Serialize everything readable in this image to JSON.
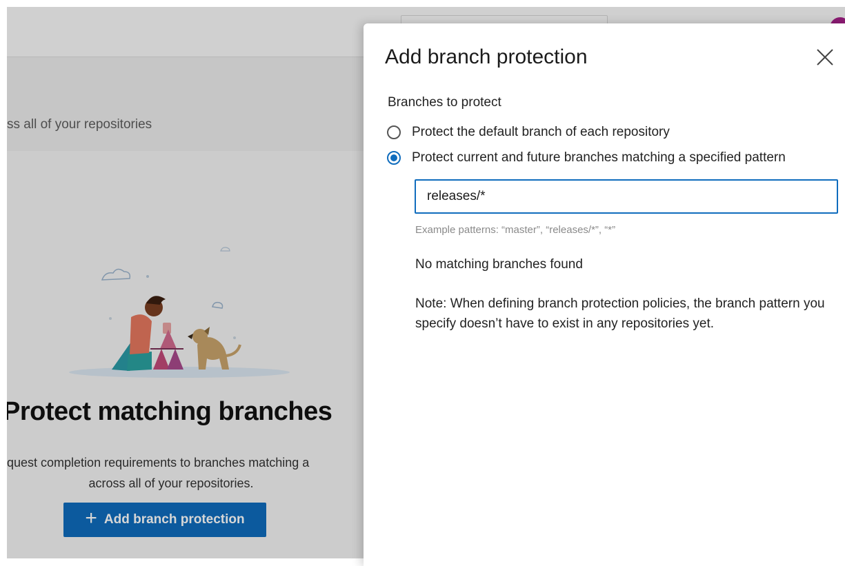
{
  "background": {
    "subtitle": "ss all of your repositories",
    "heading": "Protect matching branches",
    "description_line1": "quest completion requirements to branches matching a",
    "description_line2": "across all of your repositories.",
    "add_button_label": "Add branch protection",
    "add_button_icon": "plus-icon",
    "illustration": "person-building-card-house-with-dog",
    "primary_color": "#0f6cbd"
  },
  "dialog": {
    "title": "Add branch protection",
    "close_icon": "close-icon",
    "section_label": "Branches to protect",
    "options": [
      {
        "label": "Protect the default branch of each repository",
        "checked": false
      },
      {
        "label": "Protect current and future branches matching a specified pattern",
        "checked": true
      }
    ],
    "pattern_value": "releases/*",
    "hint": "Example patterns: “master”, “releases/*”, “*”",
    "match_status": "No matching branches found",
    "note": "Note: When defining branch protection policies, the branch pattern you specify doesn’t have to exist in any repositories yet."
  }
}
